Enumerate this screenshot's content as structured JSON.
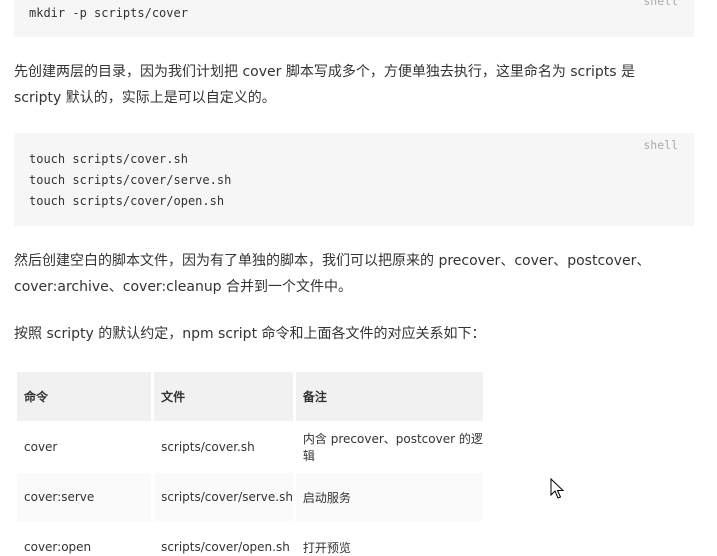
{
  "code_block_1": {
    "lang": "shell",
    "lines": [
      "mkdir -p scripts/cover"
    ]
  },
  "paragraph_1": "先创建两层的目录，因为我们计划把 cover 脚本写成多个，方便单独去执行，这里命名为 scripts 是 scripty 默认的，实际上是可以自定义的。",
  "code_block_2": {
    "lang": "shell",
    "lines": [
      "touch scripts/cover.sh",
      "touch scripts/cover/serve.sh",
      "touch scripts/cover/open.sh"
    ]
  },
  "paragraph_2": "然后创建空白的脚本文件，因为有了单独的脚本，我们可以把原来的 precover、cover、postcover、cover:archive、cover:cleanup 合并到一个文件中。",
  "paragraph_3": "按照 scripty 的默认约定，npm script 命令和上面各文件的对应关系如下：",
  "table": {
    "headers": [
      "命令",
      "文件",
      "备注"
    ],
    "rows": [
      [
        "cover",
        "scripts/cover.sh",
        "内含 precover、postcover 的逻辑"
      ],
      [
        "cover:serve",
        "scripts/cover/serve.sh",
        "启动服务"
      ],
      [
        "cover:open",
        "scripts/cover/open.sh",
        "打开预览"
      ]
    ]
  },
  "icons": {
    "cursor": "mouse-pointer-icon"
  },
  "colors": {
    "code_background": "#f6f6f6",
    "table_header_background": "#f1f1f1",
    "text": "#333333",
    "lang_label": "#aaaaaa"
  }
}
